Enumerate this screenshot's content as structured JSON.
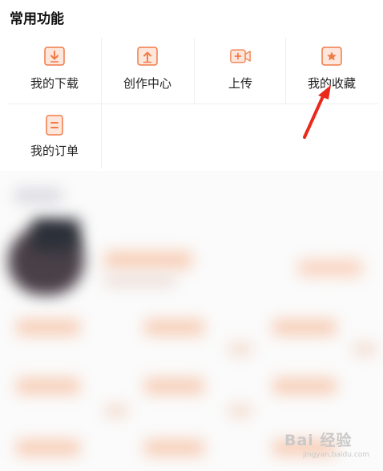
{
  "section": {
    "title": "常用功能"
  },
  "functions": [
    {
      "label": "我的下载",
      "icon": "download-icon"
    },
    {
      "label": "创作中心",
      "icon": "upload-icon"
    },
    {
      "label": "上传",
      "icon": "video-add-icon"
    },
    {
      "label": "我的收藏",
      "icon": "star-icon"
    },
    {
      "label": "我的订单",
      "icon": "order-icon"
    }
  ],
  "colors": {
    "accent": "#f07c48",
    "accent_light": "#fde7dc",
    "arrow": "#e8291c"
  },
  "watermark": {
    "text": "Bai 经验",
    "sub": "jingyan.baidu.com"
  }
}
